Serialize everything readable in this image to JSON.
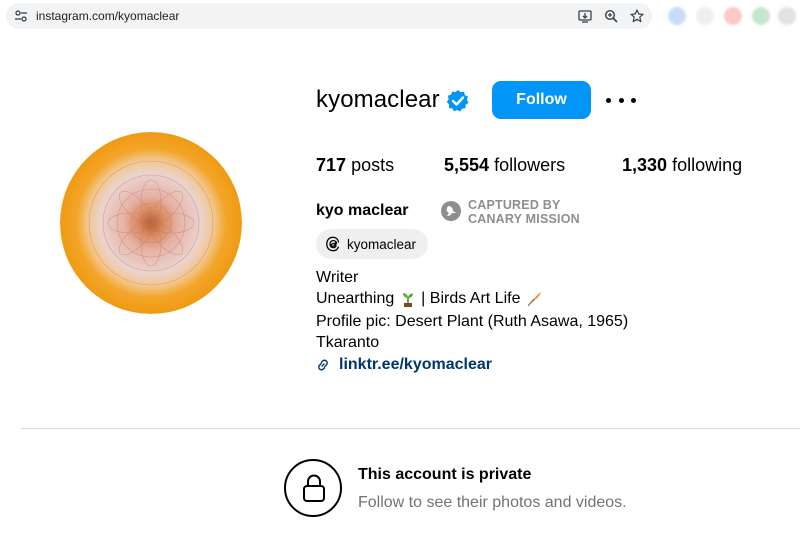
{
  "browser": {
    "url": "instagram.com/kyomaclear"
  },
  "profile": {
    "username": "kyomaclear",
    "follow_label": "Follow",
    "stats": {
      "posts_count": "717",
      "posts_label": "posts",
      "followers_count": "5,554",
      "followers_label": "followers",
      "following_count": "1,330",
      "following_label": "following"
    },
    "full_name": "kyo maclear",
    "badge_line1": "CAPTURED BY",
    "badge_line2": "CANARY MISSION",
    "threads_handle": "kyomaclear",
    "bio": {
      "line1": "Writer",
      "line2_a": "Unearthing ",
      "line2_b": " | Birds Art Life ",
      "line3": "Profile pic: Desert Plant (Ruth Asawa, 1965)",
      "line4": "Tkaranto",
      "link": "linktr.ee/kyomaclear"
    }
  },
  "private_notice": {
    "title": "This account is private",
    "subtitle": "Follow to see their photos and videos."
  },
  "colors": {
    "accent": "#0095f6",
    "link": "#00376b",
    "muted": "#737373"
  },
  "icons": [
    "site-settings-icon",
    "install-app-icon",
    "zoom-icon",
    "bookmark-star-icon",
    "verified-badge-icon",
    "more-options-icon",
    "threads-icon",
    "link-icon",
    "lock-icon"
  ]
}
